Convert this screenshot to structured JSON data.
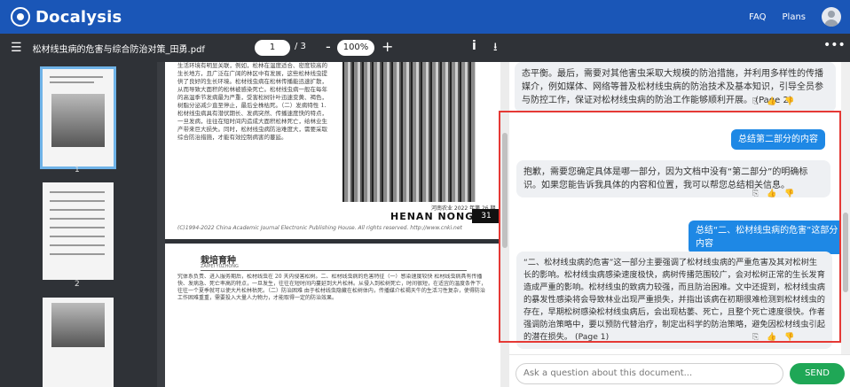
{
  "header": {
    "logo": "Docalysis",
    "faq": "FAQ",
    "plans": "Plans"
  },
  "toolbar": {
    "menu_icon": "hamburger-icon",
    "filename": "松材线虫病的危害与综合防治对策_田勇.pdf",
    "page_current": "1",
    "page_total": "/ 3",
    "zoom_out": "-",
    "zoom": "100%",
    "zoom_in": "+",
    "info_icon": "info-icon",
    "download_icon": "download-icon",
    "more_icon": "more-icon"
  },
  "thumbnails": [
    {
      "label": "1"
    },
    {
      "label": "2"
    }
  ],
  "document": {
    "page1_text": "生活环境有明显关联，例如，松林在温度适合、密度较高的生长地方，且广泛在广阔的林区中有发展，这些松林线虫提供了良好的生长环境。松材线虫病在松林传播能迅速扩散，从而导致大面积的松林被感染死亡。松材线虫病一般在每年的高温季节发病最为严重，受害松树针叶迅速变黄、褐色，树脂分泌减少直至停止，最后全株枯死。（二）发病特性 1.松材线虫病具有潜伏期长、发病突然、传播速度快的特点，一旦发病，往往在短时间内造成大面积松林死亡，给林业生产带来巨大损失。同时，松材线虫病防治难度大，需要采取综合防治措施，才能有效控制病害的蔓延。",
    "caption": "河南农业 2022 年第 26 期",
    "running_head": "HENAN  NONGYE",
    "page_number": "31",
    "copyright": "(C)1994-2022 China Academic Journal Electronic Publishing House. All rights reserved.    http://www.cnki.net",
    "section_title": "栽培育种",
    "section_sub": "ZAIPEI YUZHONG",
    "page2_text": "究体系负责、进入服务期后，松材线虫在 20 天内侵害松树。二、松材线虫病的危害特征（一）感染速度较快 松材线虫病具有传播快、发病急、死亡率高的特点，一旦发生，往往在短时间内蔓延到大片松林。从侵入到松树死亡，时间很短，在适宜的温度条件下，往往一个夏季就可以使大片松林枯死。（二）防治困难 由于松材线虫隐藏在松树体内，传播媒介松褐天牛的生活习性复杂，使得防治工作困难重重，需要投入大量人力物力，才能取得一定的防治效果。"
  },
  "chat": {
    "messages": [
      {
        "role": "ai",
        "text": "态平衡。最后，需要对其他害虫采取大规模的防治措施，并利用多样性的传播媒介，例如媒体、网络等普及松材线虫病的防治技术及基本知识，引导全员参与防控工作，保证对松材线虫病的防治工作能够顺利开展。 (Page 2)"
      },
      {
        "role": "user",
        "text": "总结第二部分的内容"
      },
      {
        "role": "ai",
        "text": "抱歉，需要您确定具体是哪一部分，因为文档中没有“第二部分”的明确标识。如果您能告诉我具体的内容和位置，我可以帮您总结相关信息。"
      },
      {
        "role": "user",
        "text": "总结“二、松材线虫病的危害”这部分内容"
      },
      {
        "role": "ai",
        "text": "“二、松材线虫病的危害”这一部分主要强调了松材线虫病的严重危害及其对松树生长的影响。松材线虫病感染速度极快，病树传播范围较广，会对松树正常的生长发育造成严重的影响。松材线虫的致病力较强，而且防治困难。文中还提到，松材线虫病的暴发性感染将会导致林业出现严重损失，并指出该病在初期很难检测到松材线虫的存在，早期松树感染松材线虫病后，会出现枯萎、死亡，且整个死亡速度很快。作者强调防治策略中，要以预防代替治疗，制定出科学的防治策略，避免因松材线虫引起的潜在损失。 (Page 1)"
      }
    ],
    "actions": "⎘ 👍 👎",
    "input_placeholder": "Ask a question about this document...",
    "send_label": "SEND"
  },
  "colors": {
    "brand": "#1a56b7",
    "toolbar": "#2f3237",
    "user_bubble": "#1e88e5",
    "send": "#1fa756",
    "highlight": "#e53935"
  }
}
